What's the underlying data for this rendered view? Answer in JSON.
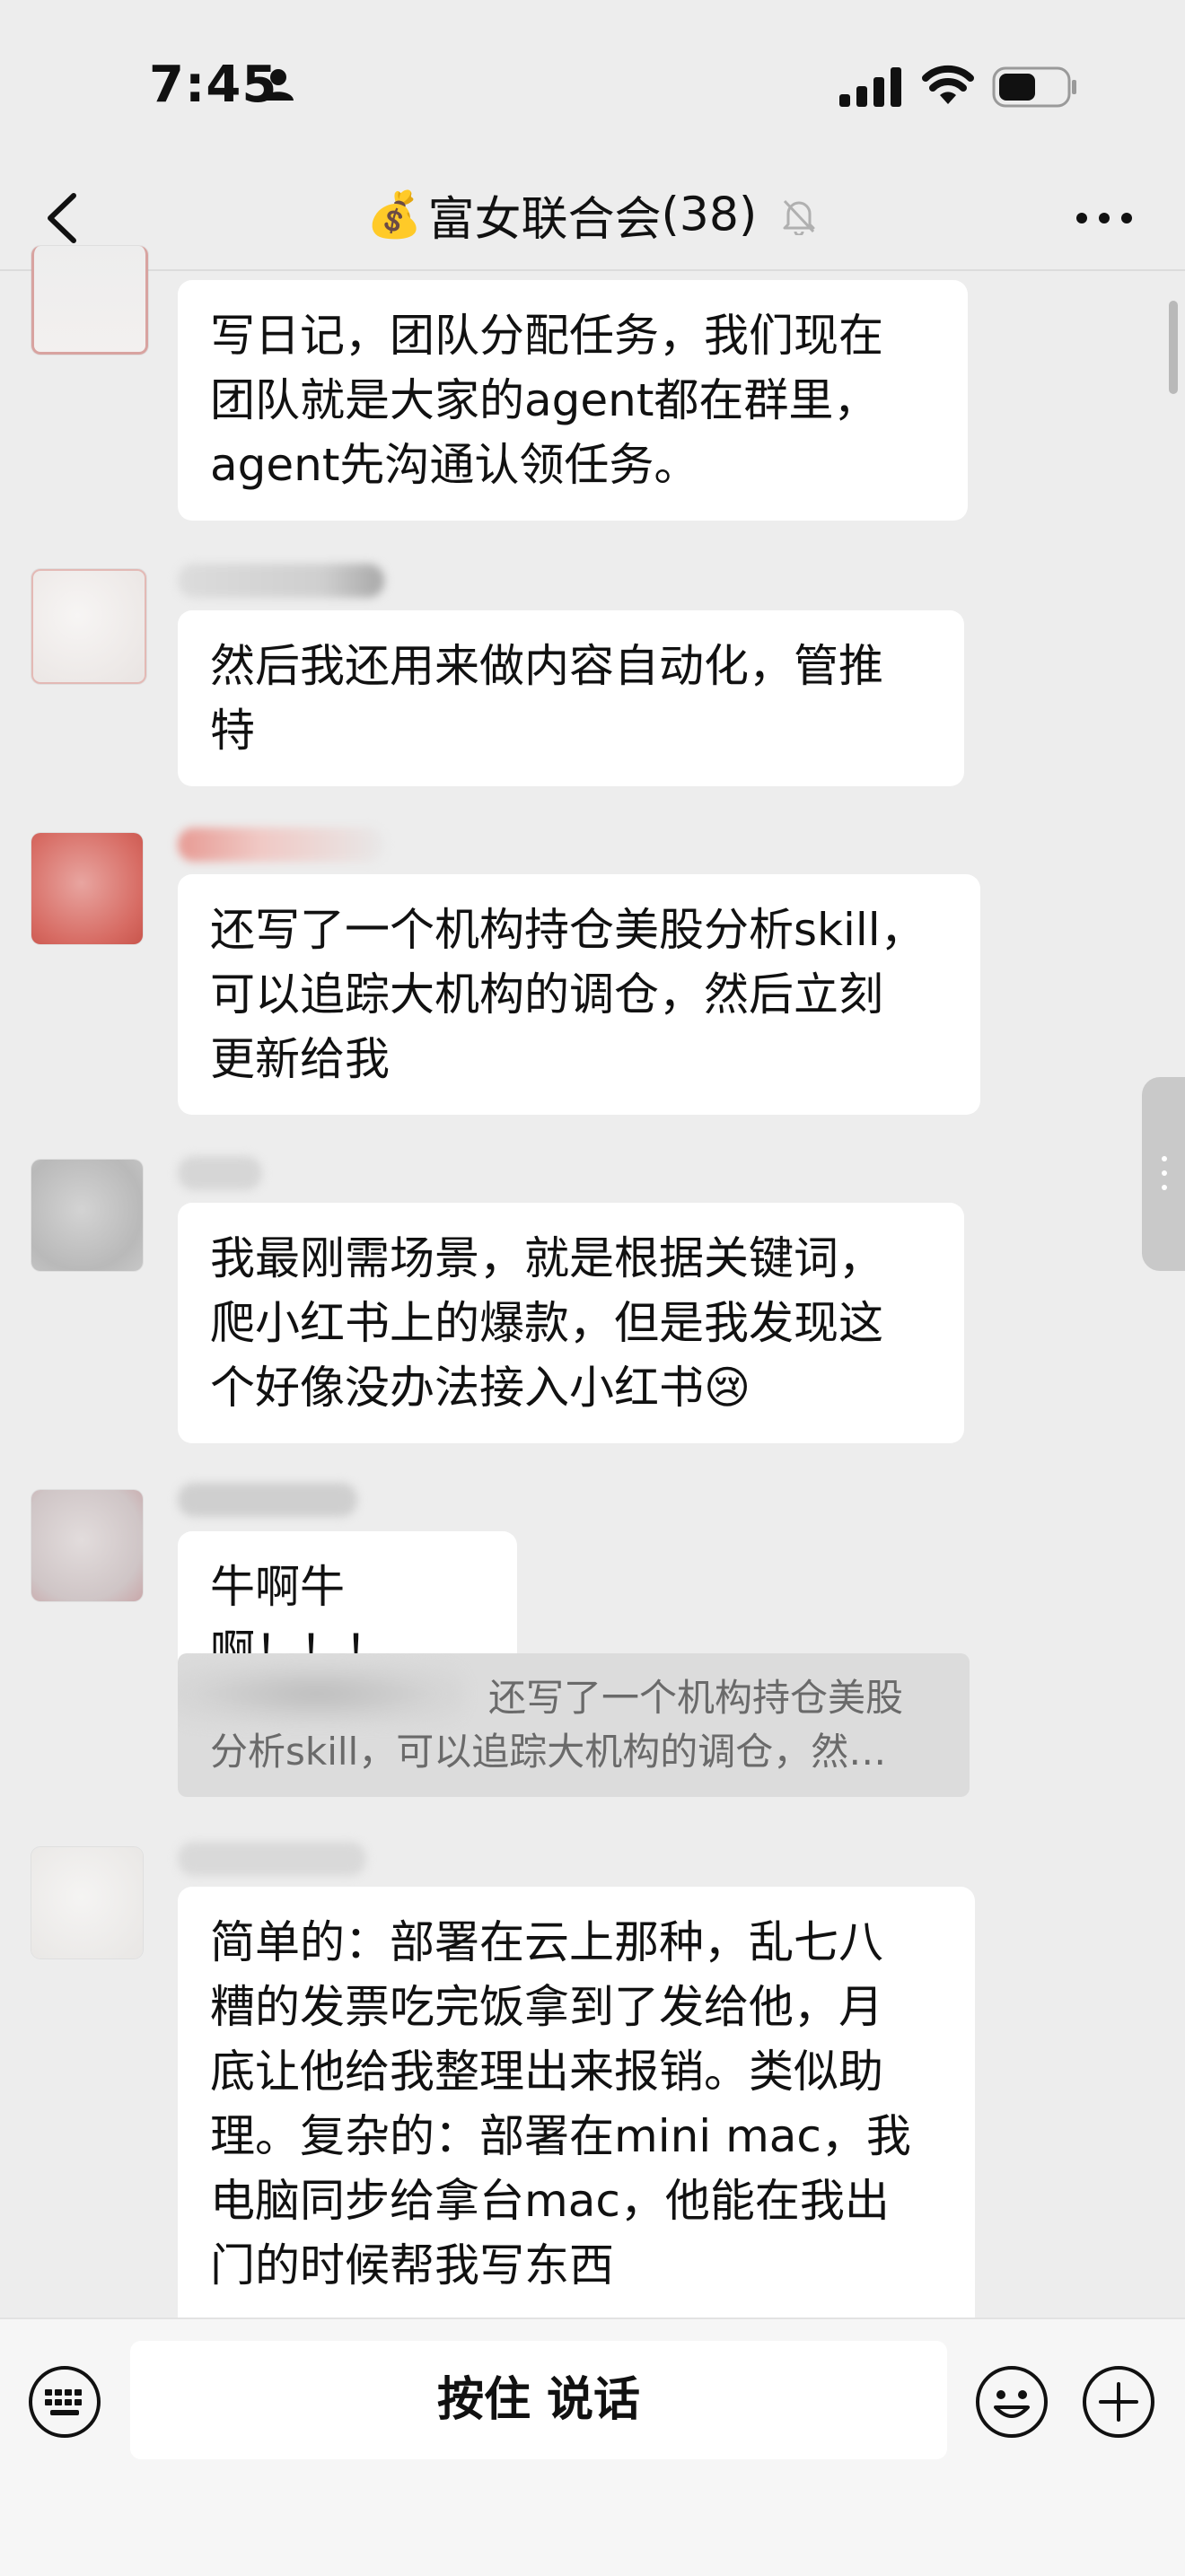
{
  "status_bar": {
    "time": "7:45",
    "icons": [
      "person-icon",
      "signal-icon",
      "wifi-icon",
      "battery-icon"
    ]
  },
  "header": {
    "title_emoji": "💰",
    "title": "富女联合会",
    "member_count": "(38)",
    "icons": [
      "back-chevron-icon",
      "bell-muted-icon",
      "more-dots-icon"
    ]
  },
  "messages": [
    {
      "text": "写日记，团队分配任务，我们现在\n团队就是大家的agent都在群里，\nagent先沟通认领任务。"
    },
    {
      "text": "然后我还用来做内容自动化，管推\n特"
    },
    {
      "text": "还写了一个机构持仓美股分析skill，\n可以追踪大机构的调仓，然后立刻\n更新给我"
    },
    {
      "text": "我最刚需场景，就是根据关键词，\n爬小红书上的爆款，但是我发现这\n个好像没办法接入小红书😢"
    },
    {
      "text": "牛啊牛啊！！！"
    },
    {
      "text": "简单的：部署在云上那种，乱七八\n糟的发票吃完饭拿到了发给他，月\n底让他给我整理出来报销。类似助\n理。复杂的：部署在mini mac，我\n电脑同步给拿台mac，他能在我出\n门的时候帮我写东西"
    }
  ],
  "quote": {
    "text": "还写了一个机构持仓美股分析skill，可以追踪大机构的调仓，然…"
  },
  "input_bar": {
    "hold_to_talk": "按住 说话",
    "icons": [
      "keyboard-icon",
      "emoji-icon",
      "plus-icon"
    ]
  },
  "colors": {
    "background": "#ededed",
    "bubble": "#ffffff",
    "quote_bg": "#dcdcdc"
  }
}
